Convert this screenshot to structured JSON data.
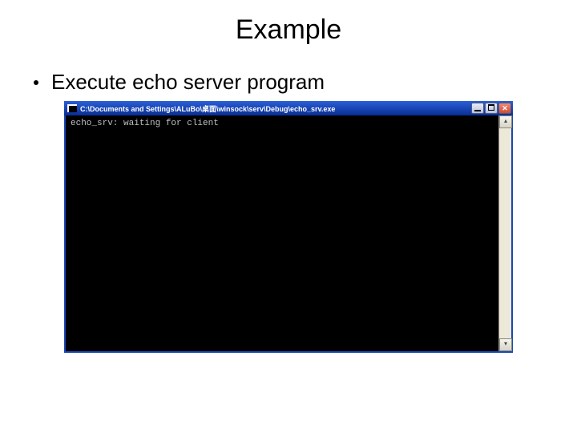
{
  "slide": {
    "title": "Example",
    "bullet": "Execute echo server program"
  },
  "window": {
    "title_path": "C:\\Documents and Settings\\ALuBo\\桌面\\winsock\\serv\\Debug\\echo_srv.exe",
    "console_output": "echo_srv: waiting for client",
    "buttons": {
      "minimize_label": "Minimize",
      "maximize_label": "Maximize",
      "close_label": "Close"
    },
    "scrollbar": {
      "up_glyph": "▴",
      "down_glyph": "▾"
    }
  }
}
